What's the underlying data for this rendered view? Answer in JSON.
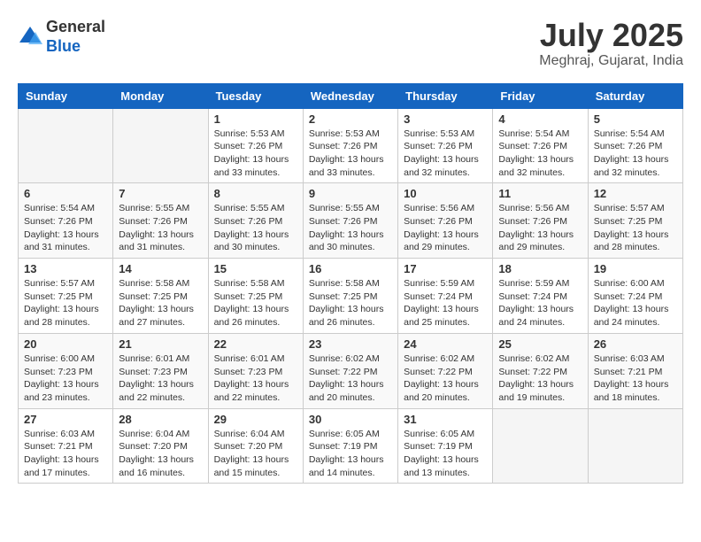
{
  "header": {
    "logo": {
      "general": "General",
      "blue": "Blue"
    },
    "title": "July 2025",
    "location": "Meghraj, Gujarat, India"
  },
  "calendar": {
    "days_of_week": [
      "Sunday",
      "Monday",
      "Tuesday",
      "Wednesday",
      "Thursday",
      "Friday",
      "Saturday"
    ],
    "weeks": [
      [
        {
          "day": "",
          "info": ""
        },
        {
          "day": "",
          "info": ""
        },
        {
          "day": "1",
          "info": "Sunrise: 5:53 AM\nSunset: 7:26 PM\nDaylight: 13 hours\nand 33 minutes."
        },
        {
          "day": "2",
          "info": "Sunrise: 5:53 AM\nSunset: 7:26 PM\nDaylight: 13 hours\nand 33 minutes."
        },
        {
          "day": "3",
          "info": "Sunrise: 5:53 AM\nSunset: 7:26 PM\nDaylight: 13 hours\nand 32 minutes."
        },
        {
          "day": "4",
          "info": "Sunrise: 5:54 AM\nSunset: 7:26 PM\nDaylight: 13 hours\nand 32 minutes."
        },
        {
          "day": "5",
          "info": "Sunrise: 5:54 AM\nSunset: 7:26 PM\nDaylight: 13 hours\nand 32 minutes."
        }
      ],
      [
        {
          "day": "6",
          "info": "Sunrise: 5:54 AM\nSunset: 7:26 PM\nDaylight: 13 hours\nand 31 minutes."
        },
        {
          "day": "7",
          "info": "Sunrise: 5:55 AM\nSunset: 7:26 PM\nDaylight: 13 hours\nand 31 minutes."
        },
        {
          "day": "8",
          "info": "Sunrise: 5:55 AM\nSunset: 7:26 PM\nDaylight: 13 hours\nand 30 minutes."
        },
        {
          "day": "9",
          "info": "Sunrise: 5:55 AM\nSunset: 7:26 PM\nDaylight: 13 hours\nand 30 minutes."
        },
        {
          "day": "10",
          "info": "Sunrise: 5:56 AM\nSunset: 7:26 PM\nDaylight: 13 hours\nand 29 minutes."
        },
        {
          "day": "11",
          "info": "Sunrise: 5:56 AM\nSunset: 7:26 PM\nDaylight: 13 hours\nand 29 minutes."
        },
        {
          "day": "12",
          "info": "Sunrise: 5:57 AM\nSunset: 7:25 PM\nDaylight: 13 hours\nand 28 minutes."
        }
      ],
      [
        {
          "day": "13",
          "info": "Sunrise: 5:57 AM\nSunset: 7:25 PM\nDaylight: 13 hours\nand 28 minutes."
        },
        {
          "day": "14",
          "info": "Sunrise: 5:58 AM\nSunset: 7:25 PM\nDaylight: 13 hours\nand 27 minutes."
        },
        {
          "day": "15",
          "info": "Sunrise: 5:58 AM\nSunset: 7:25 PM\nDaylight: 13 hours\nand 26 minutes."
        },
        {
          "day": "16",
          "info": "Sunrise: 5:58 AM\nSunset: 7:25 PM\nDaylight: 13 hours\nand 26 minutes."
        },
        {
          "day": "17",
          "info": "Sunrise: 5:59 AM\nSunset: 7:24 PM\nDaylight: 13 hours\nand 25 minutes."
        },
        {
          "day": "18",
          "info": "Sunrise: 5:59 AM\nSunset: 7:24 PM\nDaylight: 13 hours\nand 24 minutes."
        },
        {
          "day": "19",
          "info": "Sunrise: 6:00 AM\nSunset: 7:24 PM\nDaylight: 13 hours\nand 24 minutes."
        }
      ],
      [
        {
          "day": "20",
          "info": "Sunrise: 6:00 AM\nSunset: 7:23 PM\nDaylight: 13 hours\nand 23 minutes."
        },
        {
          "day": "21",
          "info": "Sunrise: 6:01 AM\nSunset: 7:23 PM\nDaylight: 13 hours\nand 22 minutes."
        },
        {
          "day": "22",
          "info": "Sunrise: 6:01 AM\nSunset: 7:23 PM\nDaylight: 13 hours\nand 22 minutes."
        },
        {
          "day": "23",
          "info": "Sunrise: 6:02 AM\nSunset: 7:22 PM\nDaylight: 13 hours\nand 20 minutes."
        },
        {
          "day": "24",
          "info": "Sunrise: 6:02 AM\nSunset: 7:22 PM\nDaylight: 13 hours\nand 20 minutes."
        },
        {
          "day": "25",
          "info": "Sunrise: 6:02 AM\nSunset: 7:22 PM\nDaylight: 13 hours\nand 19 minutes."
        },
        {
          "day": "26",
          "info": "Sunrise: 6:03 AM\nSunset: 7:21 PM\nDaylight: 13 hours\nand 18 minutes."
        }
      ],
      [
        {
          "day": "27",
          "info": "Sunrise: 6:03 AM\nSunset: 7:21 PM\nDaylight: 13 hours\nand 17 minutes."
        },
        {
          "day": "28",
          "info": "Sunrise: 6:04 AM\nSunset: 7:20 PM\nDaylight: 13 hours\nand 16 minutes."
        },
        {
          "day": "29",
          "info": "Sunrise: 6:04 AM\nSunset: 7:20 PM\nDaylight: 13 hours\nand 15 minutes."
        },
        {
          "day": "30",
          "info": "Sunrise: 6:05 AM\nSunset: 7:19 PM\nDaylight: 13 hours\nand 14 minutes."
        },
        {
          "day": "31",
          "info": "Sunrise: 6:05 AM\nSunset: 7:19 PM\nDaylight: 13 hours\nand 13 minutes."
        },
        {
          "day": "",
          "info": ""
        },
        {
          "day": "",
          "info": ""
        }
      ]
    ]
  }
}
